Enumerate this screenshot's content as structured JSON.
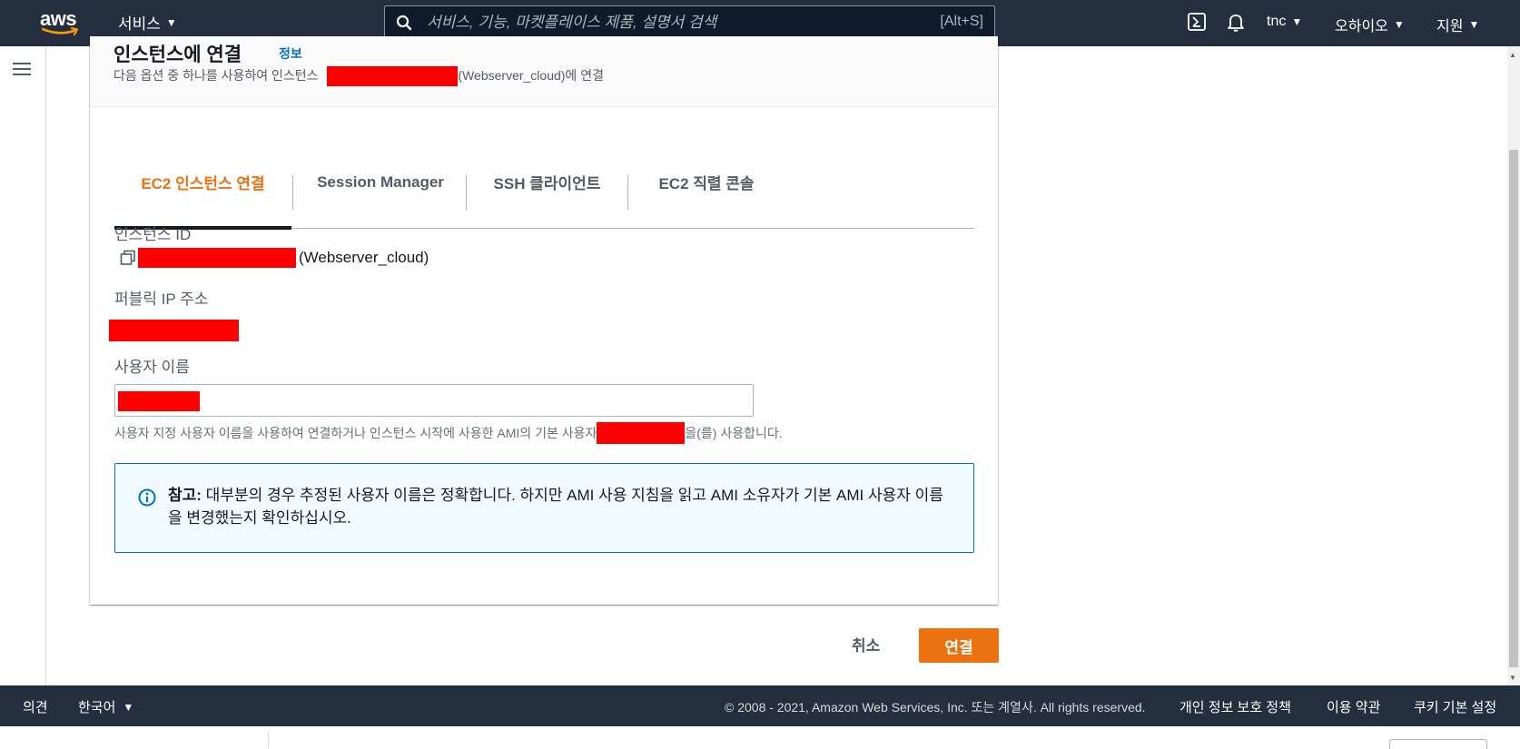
{
  "nav": {
    "logo": "aws",
    "services": "서비스",
    "search_placeholder": "서비스, 기능, 마켓플레이스 제품, 설명서 검색",
    "search_shortcut": "[Alt+S]",
    "user": "tnc",
    "region": "오하이오",
    "support": "지원"
  },
  "card": {
    "title": "인스턴스에 연결",
    "info_link": "정보",
    "subtitle_prefix": "다음 옵션 중 하나를 사용하여 인스턴스",
    "subtitle_suffix": "(Webserver_cloud)에 연결"
  },
  "tabs": [
    {
      "label": "EC2 인스턴스 연결",
      "active": true
    },
    {
      "label": "Session Manager",
      "active": false
    },
    {
      "label": "SSH 클라이언트",
      "active": false
    },
    {
      "label": "EC2 직렬 콘솔",
      "active": false
    }
  ],
  "fields": {
    "instance_id_label": "인스턴스 ID",
    "instance_name": "(Webserver_cloud)",
    "public_ip_label": "퍼블릭 IP 주소",
    "username_label": "사용자 이름",
    "username_hint_prefix": "사용자 지정 사용자 이름을 사용하여 연결하거나 인스턴스 시작에 사용한 AMI의 기본 사용자",
    "username_hint_suffix": "을(를) 사용합니다."
  },
  "alert": {
    "bold": "참고:",
    "text": " 대부분의 경우 추정된 사용자 이름은 정확합니다. 하지만 AMI 사용 지침을 읽고 AMI 소유자가 기본 AMI 사용자 이름을 변경했는지 확인하십시오."
  },
  "actions": {
    "cancel": "취소",
    "connect": "연결"
  },
  "footer": {
    "feedback": "의견",
    "language": "한국어",
    "copyright": "© 2008 - 2021, Amazon Web Services, Inc. 또는 계열사. All rights reserved.",
    "privacy": "개인 정보 보호 정책",
    "terms": "이용 약관",
    "cookies": "쿠키 기본 설정"
  },
  "colors": {
    "nav_bg": "#232f3e",
    "accent": "#ec7211",
    "link": "#0073bb",
    "redaction": "#ff0000"
  }
}
